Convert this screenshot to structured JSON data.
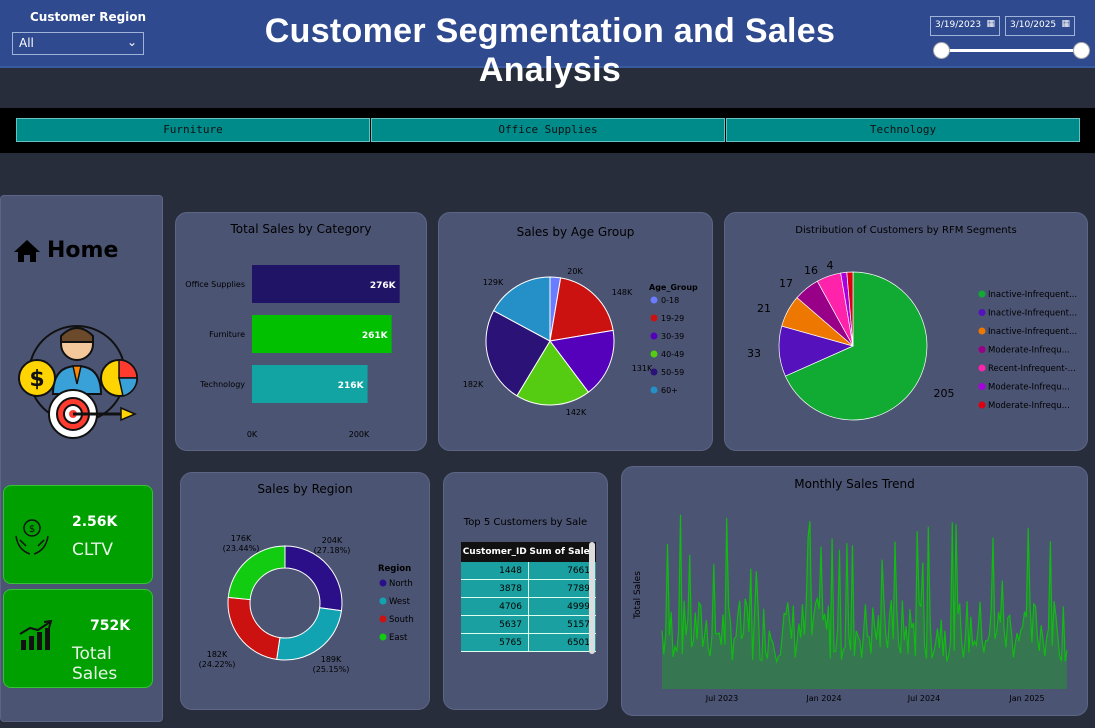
{
  "filters": {
    "region_label": "Customer Region",
    "region_value": "All",
    "date_start": "3/19/2023",
    "date_end": "3/10/2025"
  },
  "title": "Customer Segmentation and Sales Analysis",
  "categories": [
    "Furniture",
    "Office Supplies",
    "Technology"
  ],
  "sidebar": {
    "home_label": "Home"
  },
  "kpis": {
    "cltv_value": "2.56K",
    "cltv_label": "CLTV",
    "sales_value": "752K",
    "sales_label": "Total Sales"
  },
  "colors": {
    "header": "#2f4a8e",
    "accent": "#008b8b",
    "kpi_green": "#00a000"
  },
  "chart_data": [
    {
      "type": "bar",
      "title": "Total Sales by Category",
      "categories": [
        "Office Supplies",
        "Furniture",
        "Technology"
      ],
      "values": [
        276,
        261,
        216
      ],
      "labels": [
        "276K",
        "261K",
        "216K"
      ],
      "colors": [
        "#1f1466",
        "#00c000",
        "#12a3a3"
      ],
      "x_ticks": [
        "0K",
        "200K"
      ],
      "xlim": [
        0,
        300
      ]
    },
    {
      "type": "pie",
      "title": "Sales by Age Group",
      "legend_title": "Age_Group",
      "categories": [
        "0-18",
        "19-29",
        "30-39",
        "40-49",
        "50-59",
        "60+"
      ],
      "values": [
        20,
        148,
        131,
        142,
        182,
        129
      ],
      "labels": [
        "20K",
        "148K",
        "131K",
        "142K",
        "182K",
        "129K"
      ],
      "colors": [
        "#6a7cff",
        "#cc1111",
        "#5500bb",
        "#55cc11",
        "#2a1277",
        "#2590c8"
      ]
    },
    {
      "type": "pie",
      "title": "Distribution of Customers by RFM Segments",
      "categories": [
        "Inactive-Infrequent...",
        "Inactive-Infrequent...",
        "Inactive-Infrequent...",
        "Moderate-Infrequ...",
        "Recent-Infrequent-...",
        "Moderate-Infrequ...",
        "Moderate-Infrequ..."
      ],
      "values": [
        205,
        33,
        21,
        17,
        16,
        4,
        4
      ],
      "labels": [
        "205",
        "33",
        "21",
        "17",
        "16",
        "4",
        ""
      ],
      "colors": [
        "#11aa33",
        "#5511bb",
        "#ee7700",
        "#990088",
        "#ff22aa",
        "#aa00dd",
        "#dd0011"
      ]
    },
    {
      "type": "pie",
      "title": "Sales by Region",
      "legend_title": "Region",
      "categories": [
        "North",
        "West",
        "South",
        "East"
      ],
      "values": [
        204,
        189,
        182,
        176
      ],
      "labels": [
        "204K",
        "189K",
        "182K",
        "176K"
      ],
      "percents": [
        "(27.18%)",
        "(25.15%)",
        "(24.22%)",
        "(23.44%)"
      ],
      "colors": [
        "#2a0f88",
        "#12a3b3",
        "#cc1111",
        "#11cc11"
      ]
    },
    {
      "type": "table",
      "title": "Top 5 Customers by Sale",
      "columns": [
        "Customer_ID",
        "Sum of Sales"
      ],
      "rows": [
        [
          "1448",
          "7661"
        ],
        [
          "3878",
          "7789"
        ],
        [
          "4706",
          "4999"
        ],
        [
          "5637",
          "5157"
        ],
        [
          "5765",
          "6501"
        ]
      ]
    },
    {
      "type": "area",
      "title": "Monthly Sales Trend",
      "ylabel": "Total Sales",
      "x_ticks": [
        "Jul 2023",
        "Jan 2024",
        "Jul 2024",
        "Jan 2025"
      ],
      "color": "#11bb11"
    }
  ]
}
